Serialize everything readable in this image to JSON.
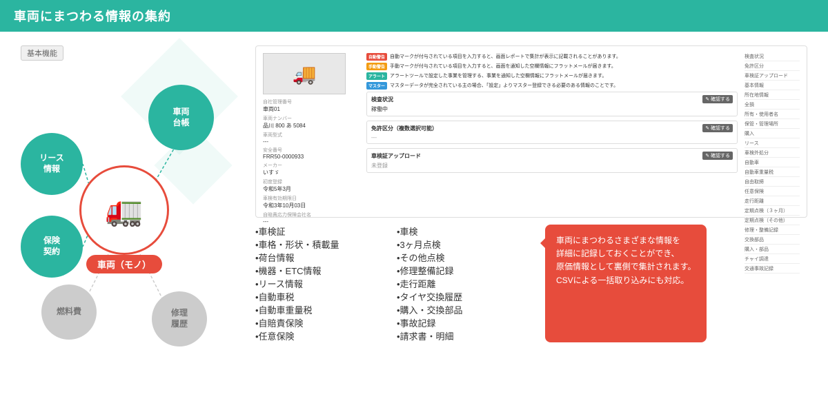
{
  "header": {
    "title": "車両にまつわる情報の集約"
  },
  "badge": {
    "label": "基本機能"
  },
  "diagram": {
    "center_label": "車両（モノ）",
    "satellites": [
      {
        "id": "sha-ryo-daichou",
        "label": "車両\n台帳"
      },
      {
        "id": "riisu",
        "label": "リース\n情報"
      },
      {
        "id": "hoken",
        "label": "保険\n契約"
      },
      {
        "id": "nenryouhi",
        "label": "燃料費"
      },
      {
        "id": "shuuri",
        "label": "修理\n履歴"
      }
    ]
  },
  "mockup": {
    "truck_emoji": "🚛",
    "alerts": [
      {
        "type": "red",
        "badge": "自動警告",
        "text": "自動マークが付与されている項目を入力すると、画面レポートで集計が表示に記載されることがあります。"
      },
      {
        "type": "yellow",
        "badge": "手動警告",
        "text": "手動マークが付与されている項目を入力すると、画面を通知した空欄情報にフラットメールが届きます。"
      },
      {
        "type": "green",
        "badge": "アラート",
        "text": "アラートツールで設定した事業を管理する、事業を通知した空欄情報にフラットメールが届きます。"
      },
      {
        "type": "blue",
        "badge": "マスター",
        "text": "マスターデータが完全されている主の場合、「設定」よりマスター登録できる必要のある情報のことです。"
      }
    ],
    "vehicle_info": {
      "label1": "自社管理番号",
      "value1": "車両01",
      "label2": "車両ナンバー",
      "value2": "品川 800 あ 5084",
      "label3": "車両型式",
      "value3": "---",
      "label4": "安全番号",
      "value4": "FRR50-0000933",
      "label5": "メーカー",
      "value5": "いすゞ",
      "label6": "初度登録",
      "value6": "令和5年3月",
      "label7": "車検有効期限日",
      "value7": "令和3年10月03日",
      "label8": "自賠責応力保険会社名",
      "value8": "---"
    },
    "sections": [
      {
        "id": "kensa-joukyou",
        "title": "検査状況",
        "value": "稼働中"
      },
      {
        "id": "menkyoku-kubun",
        "title": "免許区分（複数選択可能）"
      },
      {
        "id": "shaken-upload",
        "title": "車検証アップロード"
      }
    ],
    "right_items": [
      "検査状況",
      "免許区分",
      "車検証アップロード",
      "基本情報",
      "所在地情報",
      "全損",
      "所有・使用者名",
      "保管・管理場所",
      "購入",
      "リース",
      "車検外処分",
      "自動車",
      "自動車重量税",
      "自由取締",
      "任意保険",
      "走行距離",
      "定期点検（３ヶ月）",
      "定期点検（その他）",
      "修理・整備記録",
      "交換部品",
      "購入・部品",
      "チャイ調達",
      "交通事故記録"
    ]
  },
  "bullet_list": {
    "items_left": [
      "•車検証",
      "•車格・形状・積載量",
      "•荷台情報",
      "•機器・ETC情報",
      "•リース情報",
      "•自動車税",
      "•自動車重量税",
      "•自賠責保険",
      "•任意保険"
    ],
    "items_right": [
      "•車検",
      "•3ヶ月点検",
      "•その他点検",
      "•修理整備記録",
      "•走行距離",
      "•タイヤ交換履歴",
      "•購入・交換部品",
      "•事故記録",
      "•請求書・明細"
    ]
  },
  "speech_bubble": {
    "text": "車両にまつわるさまざまな情報を\n詳細に記録しておくことができ、\n原価情報として裏側で集計されます。\nCSVによる一括取り込みにも対応。"
  }
}
